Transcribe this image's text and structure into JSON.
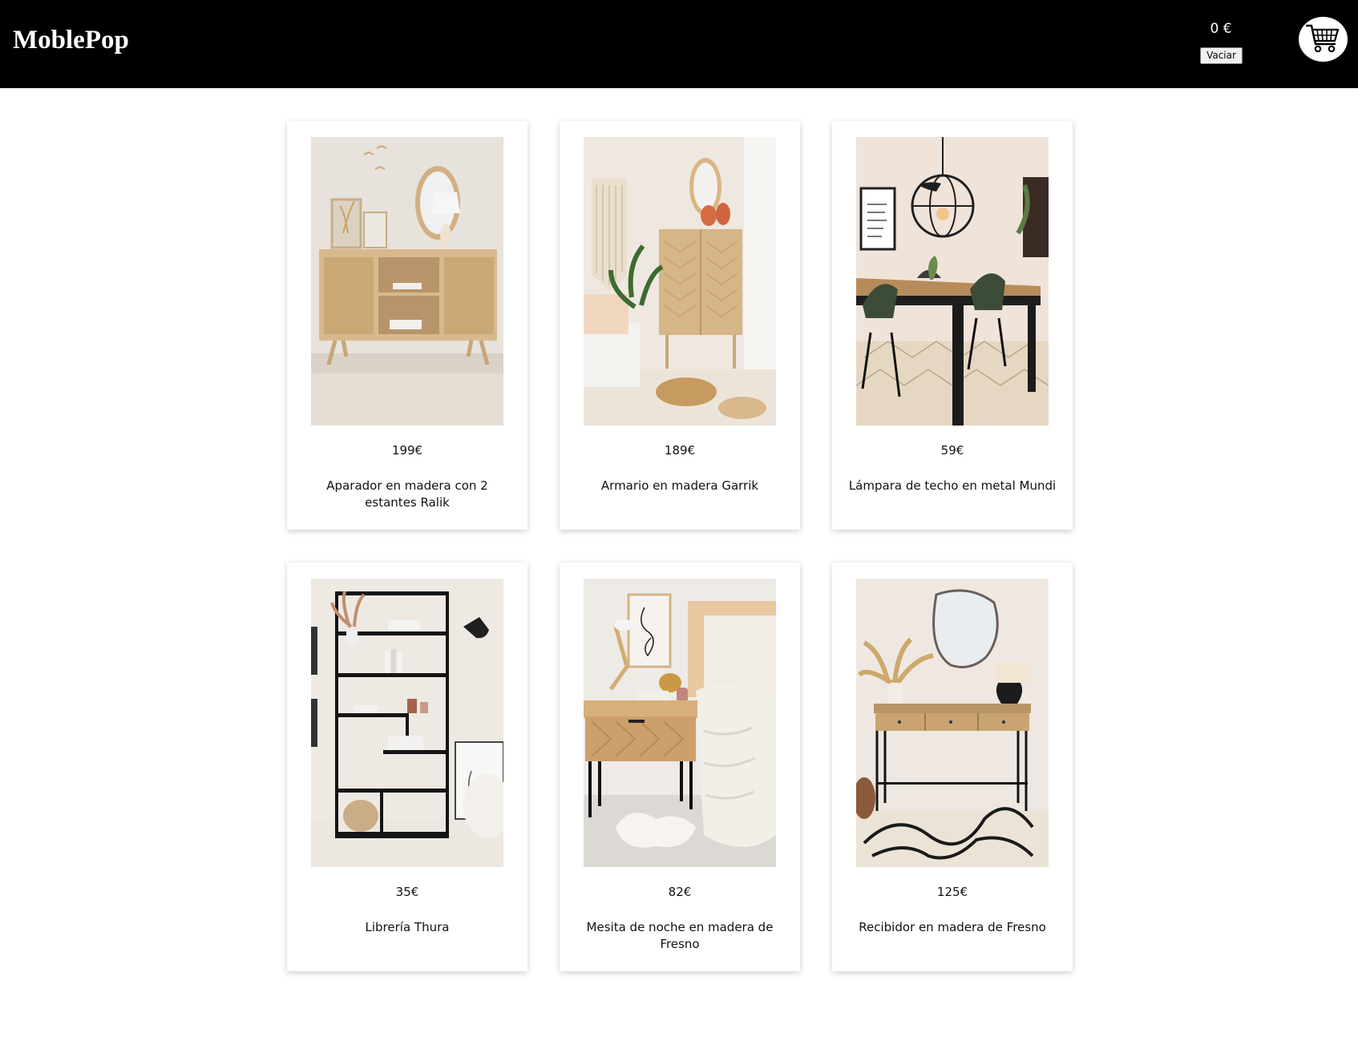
{
  "header": {
    "brand": "MoblePop",
    "cart_total": "0 €",
    "empty_label": "Vaciar",
    "cart_icon": "shopping-cart-icon",
    "background_color": "#000000"
  },
  "products": [
    {
      "price": "199€",
      "name": "Aparador en madera con 2 estantes Ralik",
      "image_icon": "sideboard-photo"
    },
    {
      "price": "189€",
      "name": "Armario en madera Garrik",
      "image_icon": "cabinet-photo"
    },
    {
      "price": "59€",
      "name": "Lámpara de techo en metal Mundi",
      "image_icon": "ceiling-lamp-photo"
    },
    {
      "price": "35€",
      "name": "Librería Thura",
      "image_icon": "bookcase-photo"
    },
    {
      "price": "82€",
      "name": "Mesita de noche en madera de Fresno",
      "image_icon": "nightstand-photo"
    },
    {
      "price": "125€",
      "name": "Recibidor en madera de Fresno",
      "image_icon": "console-table-photo"
    }
  ]
}
